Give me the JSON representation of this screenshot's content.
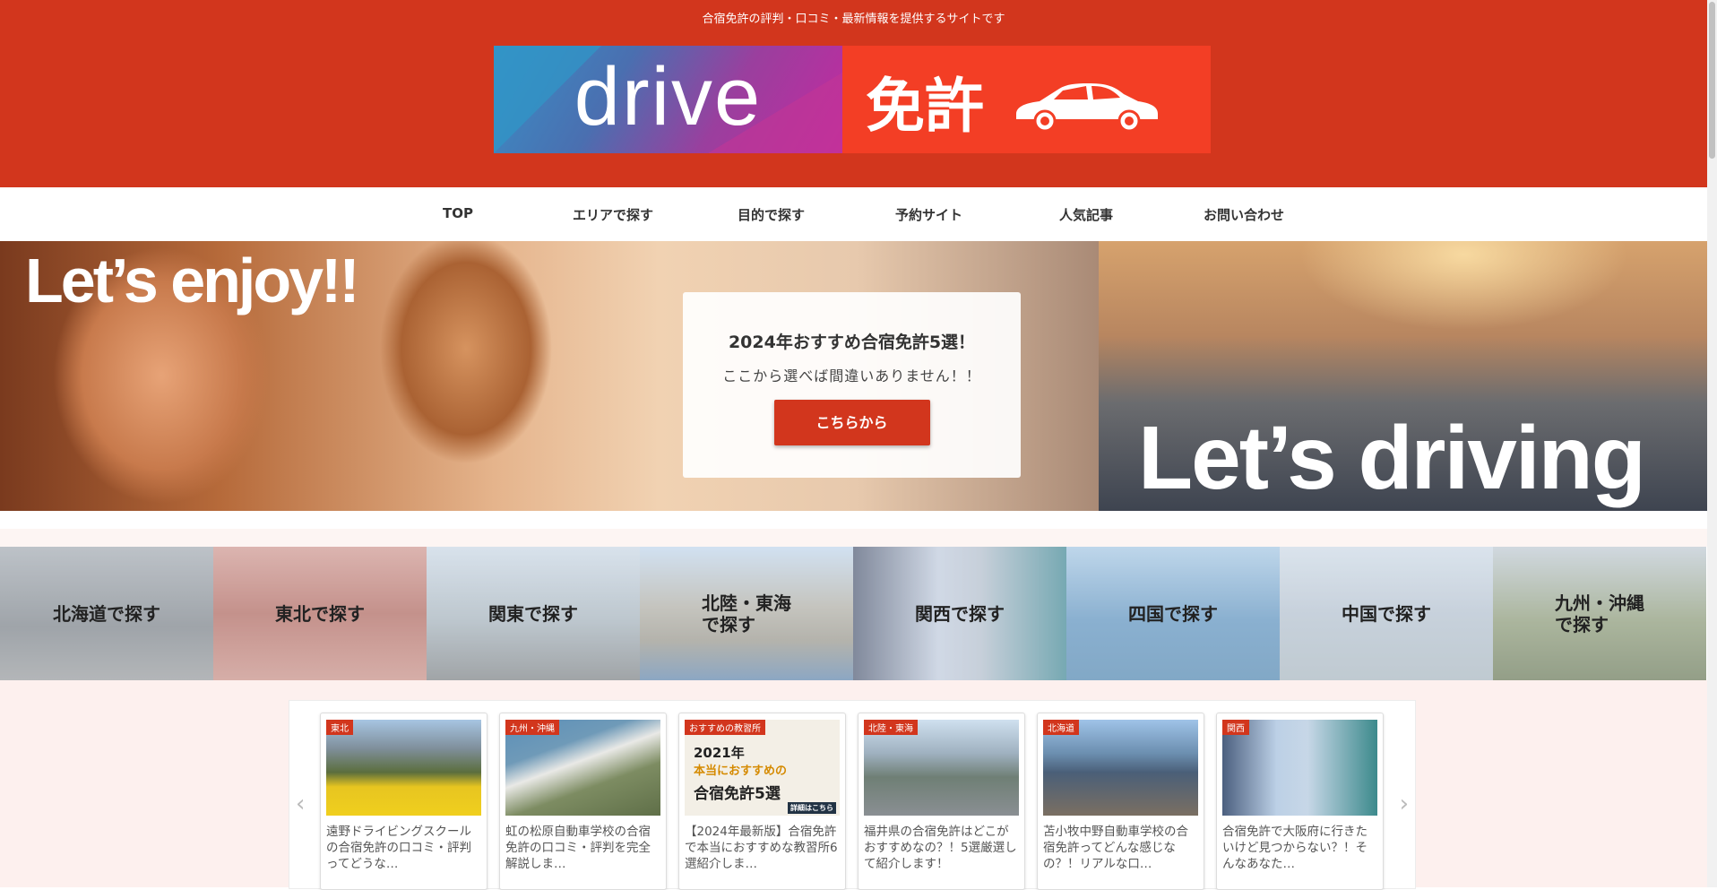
{
  "header": {
    "tagline": "合宿免許の評判・口コミ・最新情報を提供するサイトです",
    "logo_word": "drive",
    "logo_kanji": "免許",
    "colors": {
      "primary": "#d2361d",
      "logo_red": "#f33e25"
    }
  },
  "nav": {
    "items": [
      "TOP",
      "エリアで探す",
      "目的で探す",
      "予約サイト",
      "人気記事",
      "お問い合わせ"
    ]
  },
  "hero": {
    "left_text": "Let’s enjoy!!",
    "right_text": "Let’s driving",
    "promo_title": "2024年おすすめ合宿免許5選！",
    "promo_sub": "ここから選べば間違いありません！！",
    "promo_button": "こちらから"
  },
  "areas": [
    "北海道で探す",
    "東北で探す",
    "関東で探す",
    "北陸・東海\nで探す",
    "関西で探す",
    "四国で探す",
    "中国で探す",
    "九州・沖縄\nで探す"
  ],
  "cards": [
    {
      "tag": "東北",
      "text": "遠野ドライビングスクールの合宿免許の口コミ・評判ってどうな…"
    },
    {
      "tag": "九州・沖縄",
      "text": "虹の松原自動車学校の合宿免許の口コミ・評判を完全解説しま…"
    },
    {
      "tag": "おすすめの教習所",
      "text": "【2024年最新版】合宿免許で本当におすすめな教習所6選紹介しま…",
      "img_title1": "2021年",
      "img_title2": "本当におすすめの",
      "img_title3": "合宿免許5選",
      "img_note": "詳細はこちら"
    },
    {
      "tag": "北陸・東海",
      "text": "福井県の合宿免許はどこがおすすめなの？！5選厳選して紹介します！"
    },
    {
      "tag": "北海道",
      "text": "苫小牧中野自動車学校の合宿免許ってどんな感じなの？！リアルな口…"
    },
    {
      "tag": "関西",
      "text": "合宿免許で大阪府に行きたいけど見つからない？！そんなあなた…"
    }
  ],
  "carousel": {
    "prev_icon": "‹",
    "next_icon": "›"
  }
}
